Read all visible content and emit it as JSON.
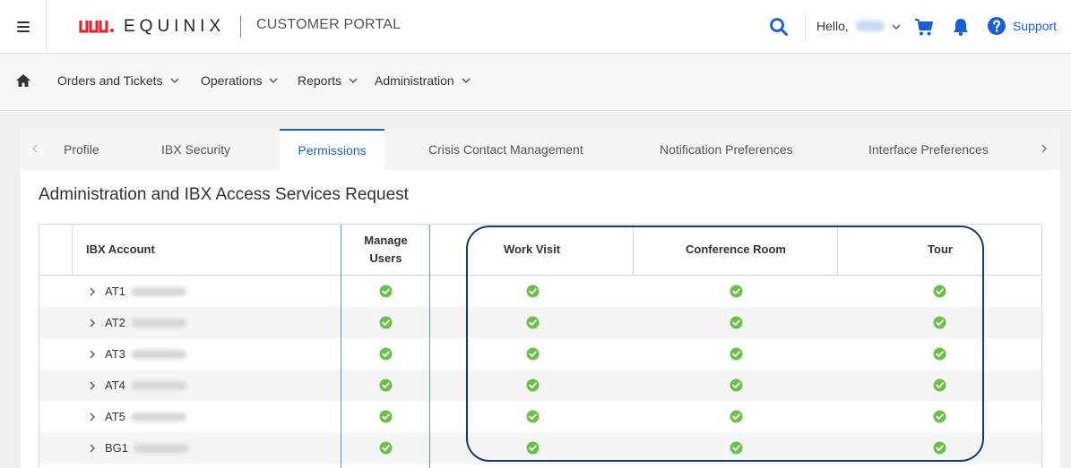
{
  "header": {
    "logo_text": "EQUINIX",
    "portal_title": "CUSTOMER PORTAL",
    "greeting": "Hello,",
    "support_label": "Support"
  },
  "nav": {
    "items": [
      {
        "label": "Orders and Tickets"
      },
      {
        "label": "Operations"
      },
      {
        "label": "Reports"
      },
      {
        "label": "Administration"
      }
    ]
  },
  "tabs": [
    {
      "label": "Profile",
      "active": false
    },
    {
      "label": "IBX Security",
      "active": false
    },
    {
      "label": "Permissions",
      "active": true
    },
    {
      "label": "Crisis Contact Management",
      "active": false
    },
    {
      "label": "Notification Preferences",
      "active": false
    },
    {
      "label": "Interface Preferences",
      "active": false
    }
  ],
  "section_title": "Administration and IBX Access Services Request",
  "table": {
    "columns": {
      "account": "IBX Account",
      "manage_users_1": "Manage",
      "manage_users_2": "Users",
      "work_visit": "Work Visit",
      "conference_room": "Conference Room",
      "tour": "Tour"
    },
    "rows": [
      {
        "account": "AT1"
      },
      {
        "account": "AT2"
      },
      {
        "account": "AT3"
      },
      {
        "account": "AT4"
      },
      {
        "account": "AT5"
      },
      {
        "account": "BG1"
      }
    ]
  },
  "colors": {
    "accent": "#1a5fd6",
    "check": "#6cc04a",
    "highlight_border": "#153a6e",
    "brand_red": "#e0282e"
  }
}
